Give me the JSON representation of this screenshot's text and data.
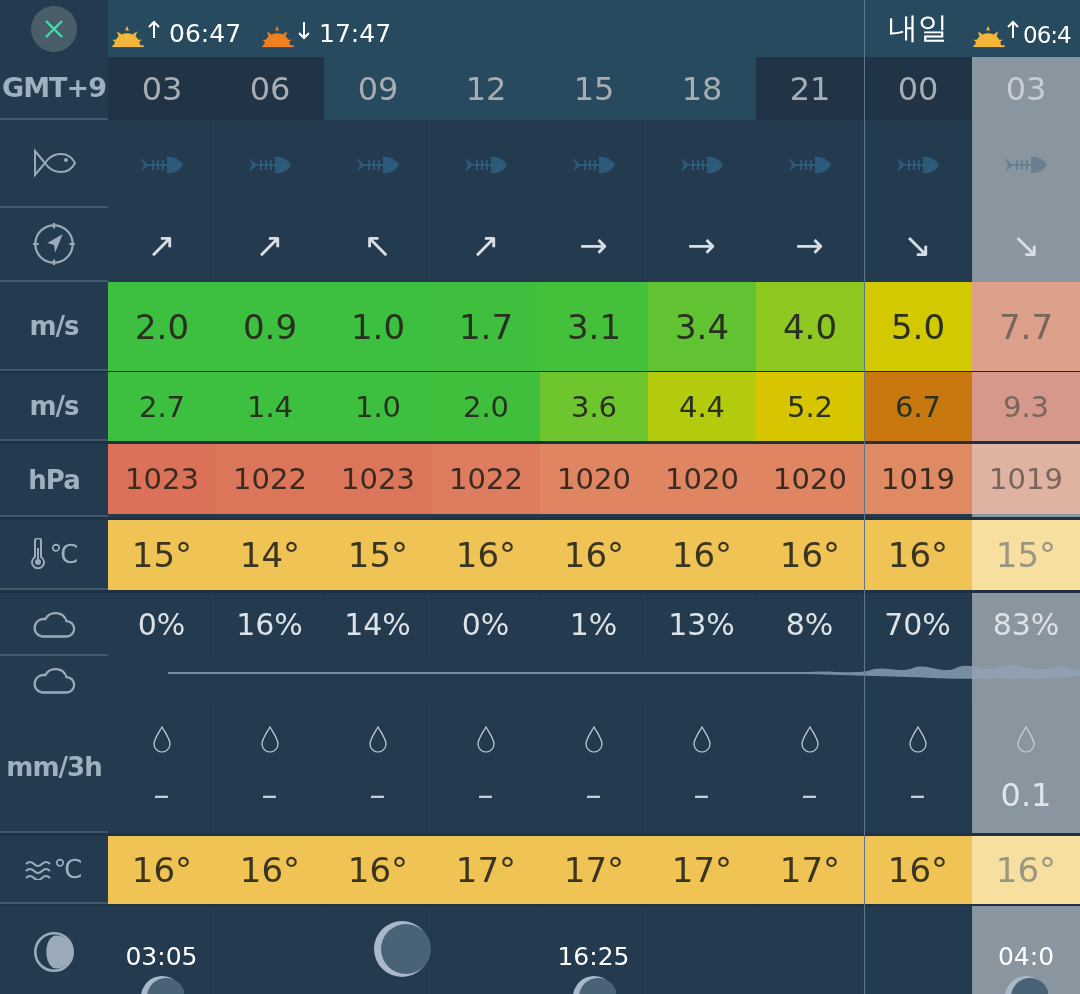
{
  "header": {
    "today_sun": [
      {
        "kind": "sunrise",
        "time": "06:47"
      },
      {
        "kind": "sunset",
        "time": "17:47"
      }
    ],
    "next_day_label": "내일",
    "next_day_sun": [
      {
        "kind": "sunrise",
        "time": "06:4"
      }
    ]
  },
  "labels": {
    "timezone": "GMT+9",
    "wind": "m/s",
    "gust": "m/s",
    "pressure": "hPa",
    "temperature": "℃",
    "rain": "mm/3h",
    "water_temperature": "℃"
  },
  "columns": [
    {
      "hour": "03",
      "daylight": false,
      "selected": false,
      "day_start": false,
      "direction": "↗",
      "wind": {
        "value": "2.0",
        "color": "#3dbf3f"
      },
      "gust": {
        "value": "2.7",
        "color": "#3dbf3f"
      },
      "pressure": {
        "value": "1023",
        "color": "#db7158"
      },
      "temperature": "15°",
      "cloud": "0%",
      "rain": "–",
      "water_temperature": "16°",
      "moon": {
        "kind": "moonrise",
        "time": "03:05"
      }
    },
    {
      "hour": "06",
      "daylight": false,
      "selected": false,
      "day_start": false,
      "direction": "↗",
      "wind": {
        "value": "0.9",
        "color": "#3dbf3f"
      },
      "gust": {
        "value": "1.4",
        "color": "#3dbf3f"
      },
      "pressure": {
        "value": "1022",
        "color": "#dc765a"
      },
      "temperature": "14°",
      "cloud": "16%",
      "rain": "–",
      "water_temperature": "16°"
    },
    {
      "hour": "09",
      "daylight": true,
      "selected": false,
      "day_start": false,
      "direction": "↖",
      "wind": {
        "value": "1.0",
        "color": "#3dbf3f"
      },
      "gust": {
        "value": "1.0",
        "color": "#3dbf3f"
      },
      "pressure": {
        "value": "1023",
        "color": "#dc765a"
      },
      "temperature": "15°",
      "cloud": "14%",
      "rain": "–",
      "water_temperature": "16°",
      "moon": {
        "kind": "phase"
      }
    },
    {
      "hour": "12",
      "daylight": true,
      "selected": false,
      "day_start": false,
      "direction": "↗",
      "wind": {
        "value": "1.7",
        "color": "#3fbf3e"
      },
      "gust": {
        "value": "2.0",
        "color": "#40bf3d"
      },
      "pressure": {
        "value": "1022",
        "color": "#dd7c5e"
      },
      "temperature": "16°",
      "cloud": "0%",
      "rain": "–",
      "water_temperature": "17°"
    },
    {
      "hour": "15",
      "daylight": true,
      "selected": false,
      "day_start": false,
      "direction": "→",
      "wind": {
        "value": "3.1",
        "color": "#45c03a"
      },
      "gust": {
        "value": "3.6",
        "color": "#6ec52e"
      },
      "pressure": {
        "value": "1020",
        "color": "#df8562"
      },
      "temperature": "16°",
      "cloud": "1%",
      "rain": "–",
      "water_temperature": "17°",
      "moon": {
        "kind": "moonrise",
        "time": "16:25"
      }
    },
    {
      "hour": "18",
      "daylight": true,
      "selected": false,
      "day_start": false,
      "direction": "→",
      "wind": {
        "value": "3.4",
        "color": "#62c332"
      },
      "gust": {
        "value": "4.4",
        "color": "#b3cb0c"
      },
      "pressure": {
        "value": "1020",
        "color": "#df8562"
      },
      "temperature": "16°",
      "cloud": "13%",
      "rain": "–",
      "water_temperature": "17°"
    },
    {
      "hour": "21",
      "daylight": false,
      "selected": false,
      "day_start": false,
      "direction": "→",
      "wind": {
        "value": "4.0",
        "color": "#8fc821"
      },
      "gust": {
        "value": "5.2",
        "color": "#d6c500"
      },
      "pressure": {
        "value": "1020",
        "color": "#df8562"
      },
      "temperature": "16°",
      "cloud": "8%",
      "rain": "–",
      "water_temperature": "17°"
    },
    {
      "hour": "00",
      "daylight": false,
      "selected": false,
      "day_start": true,
      "direction": "↘",
      "wind": {
        "value": "5.0",
        "color": "#d2c900"
      },
      "gust": {
        "value": "6.7",
        "color": "#c8780e"
      },
      "pressure": {
        "value": "1019",
        "color": "#e08a64"
      },
      "temperature": "16°",
      "cloud": "70%",
      "rain": "–",
      "water_temperature": "16°"
    },
    {
      "hour": "03",
      "daylight": false,
      "selected": true,
      "day_start": false,
      "direction": "↘",
      "wind": {
        "value": "7.7",
        "color": "#dca08b"
      },
      "gust": {
        "value": "9.3",
        "color": "#d6988a"
      },
      "pressure": {
        "value": "1019",
        "color": "#dfb2a2"
      },
      "temperature": "15°",
      "cloud": "83%",
      "rain": "0.1",
      "water_temperature": "16°",
      "moon": {
        "kind": "moonrise",
        "time": "04:0"
      }
    }
  ]
}
